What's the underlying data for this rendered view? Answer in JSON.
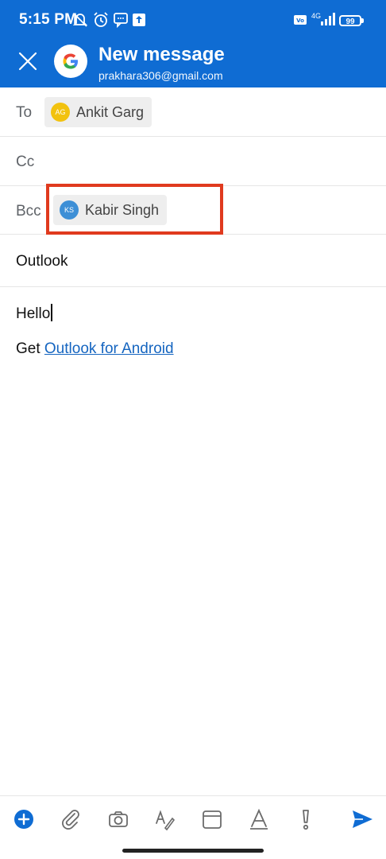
{
  "status_bar": {
    "time": "5:15 PM",
    "network": "4G",
    "battery": "99",
    "icons": [
      "muted-icon",
      "alarm-icon",
      "message-icon",
      "upload-icon",
      "volte-icon",
      "signal-icon",
      "battery-icon"
    ]
  },
  "header": {
    "title": "New message",
    "account_email": "prakhara306@gmail.com",
    "close_icon": "close-icon",
    "account_icon": "google-logo-icon"
  },
  "fields": {
    "to": {
      "label": "To",
      "recipients": [
        {
          "initials": "AG",
          "name": "Ankit Garg",
          "color": "#f2c20f"
        }
      ]
    },
    "cc": {
      "label": "Cc",
      "recipients": []
    },
    "bcc": {
      "label": "Bcc",
      "recipients": [
        {
          "initials": "KS",
          "name": "Kabir Singh",
          "color": "#3d8fd6"
        }
      ]
    }
  },
  "subject": "Outlook",
  "body": {
    "text": "Hello",
    "signature_prefix": "Get",
    "signature_link": "Outlook for Android"
  },
  "toolbar": {
    "icons": [
      "add-icon",
      "attach-icon",
      "camera-icon",
      "draw-icon",
      "calendar-icon",
      "format-text-icon",
      "importance-icon",
      "send-icon"
    ]
  },
  "colors": {
    "brand_blue": "#0f6cd3",
    "highlight_red": "#e03a1e",
    "link_blue": "#1565c0"
  }
}
